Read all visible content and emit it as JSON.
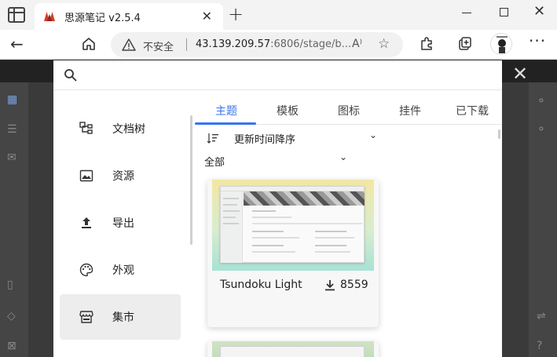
{
  "browser": {
    "tab_title": "思源笔记 v2.5.4",
    "security_label": "不安全",
    "url_host": "43.139.209.57",
    "url_rest": ":6806/stage/b...",
    "read_aloud_label": "A⁾"
  },
  "dialog": {
    "sidebar": [
      {
        "label": "文档树",
        "icon": "file-tree-icon"
      },
      {
        "label": "资源",
        "icon": "image-icon"
      },
      {
        "label": "导出",
        "icon": "upload-icon"
      },
      {
        "label": "外观",
        "icon": "palette-icon"
      },
      {
        "label": "集市",
        "icon": "store-icon",
        "active": true
      }
    ],
    "tabs": [
      {
        "label": "主题",
        "active": true
      },
      {
        "label": "模板"
      },
      {
        "label": "图标"
      },
      {
        "label": "挂件"
      },
      {
        "label": "已下载"
      }
    ],
    "sort_value": "更新时间降序",
    "filter_value": "全部",
    "cards": [
      {
        "name": "Tsundoku Light",
        "downloads": "8559"
      }
    ]
  },
  "colors": {
    "accent": "#3574f0",
    "dialog_bg": "#ffffff",
    "sidebar_active_bg": "#ededed"
  }
}
